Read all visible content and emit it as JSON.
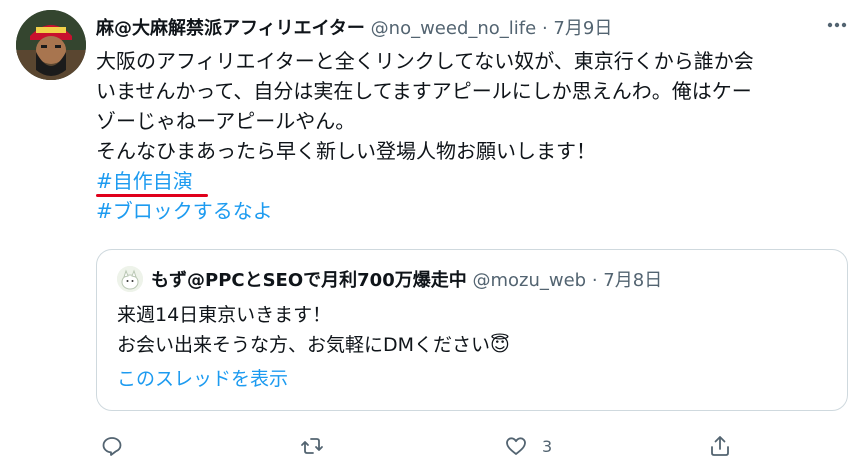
{
  "tweet": {
    "display_name": "麻@大麻解禁派アフィリエイター",
    "handle": "@no_weed_no_life",
    "separator": "·",
    "date": "7月9日",
    "lines": [
      "大阪のアフィリエイターと全くリンクしてない奴が、東京行くから誰か会",
      "いませんかって、自分は実在してますアピールにしか思えんわ。俺はケー",
      "ゾーじゃねーアピールやん。",
      "そんなひまあったら早く新しい登場人物お願いします！"
    ],
    "hashtags": [
      "#自作自演",
      "#ブロックするなよ"
    ],
    "more_icon": "more-horizontal-icon"
  },
  "quoted": {
    "display_name": "もず@PPCとSEOで月利700万爆走中",
    "handle": "@mozu_web",
    "separator": "·",
    "date": "7月8日",
    "lines": [
      "来週14日東京いきます！",
      "お会い出来そうな方、お気軽にDMください"
    ],
    "emoji": "😇",
    "show_thread": "このスレッドを表示"
  },
  "actions": {
    "reply_icon": "reply-icon",
    "retweet_icon": "retweet-icon",
    "like_icon": "like-icon",
    "like_count": "3",
    "share_icon": "share-icon"
  },
  "colors": {
    "link": "#1d9bf0",
    "muted": "#536471",
    "text": "#0f1419",
    "annotation_underline": "#e0001b",
    "border": "#cfd9de"
  }
}
